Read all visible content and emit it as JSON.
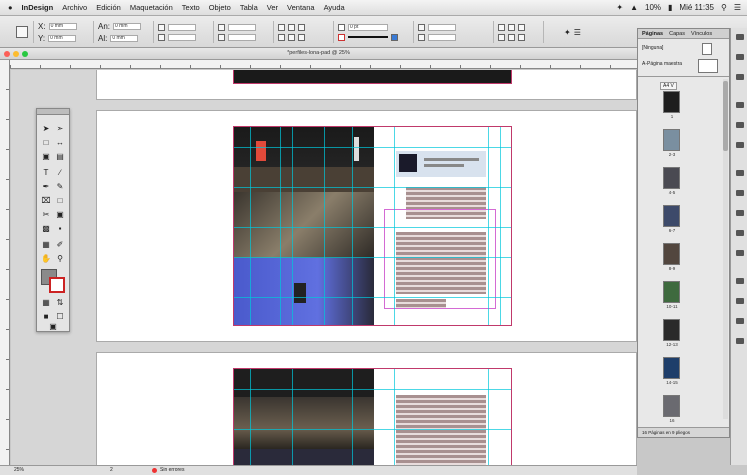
{
  "menubar": {
    "apple": "",
    "app_name": "InDesign",
    "items": [
      "Archivo",
      "Edición",
      "Maquetación",
      "Texto",
      "Objeto",
      "Tabla",
      "Ver",
      "Ventana",
      "Ayuda"
    ],
    "battery": "10%",
    "clock": "Mié 11:35"
  },
  "controlbar": {
    "x_field": "0 mm",
    "y_field": "0 mm",
    "w_field": "0 mm",
    "h_field": "0 mm",
    "stroke_field": "0 pt"
  },
  "document": {
    "title": "*perfiles-lona-pad @ 25%"
  },
  "pages_panel": {
    "tabs": [
      "Páginas",
      "Capas",
      "Vínculos"
    ],
    "masters_label": "[Ninguna]",
    "master_a": "A-Página maestra",
    "pages_selector": "A4 V",
    "thumbs": [
      {
        "label": "1",
        "color": "#1e1e1e"
      },
      {
        "label": "2-3",
        "color": "#7a8fa0"
      },
      {
        "label": "4-5",
        "color": "#4a4a52"
      },
      {
        "label": "6-7",
        "color": "#3d4a6a"
      },
      {
        "label": "8-9",
        "color": "#52463e"
      },
      {
        "label": "10-11",
        "color": "#3e6a3e"
      },
      {
        "label": "12-13",
        "color": "#2a2a2a"
      },
      {
        "label": "14-15",
        "color": "#1e3e6a"
      },
      {
        "label": "16",
        "color": "#6a6a70"
      }
    ],
    "footer": "16 Páginas en 9 pliegos"
  },
  "status": {
    "zoom": "25%",
    "page": "2",
    "errors": "Sin errores"
  },
  "colors": {
    "guide": "#00c8dc",
    "page_border": "#c0396b",
    "frame": "#d46ad4"
  }
}
